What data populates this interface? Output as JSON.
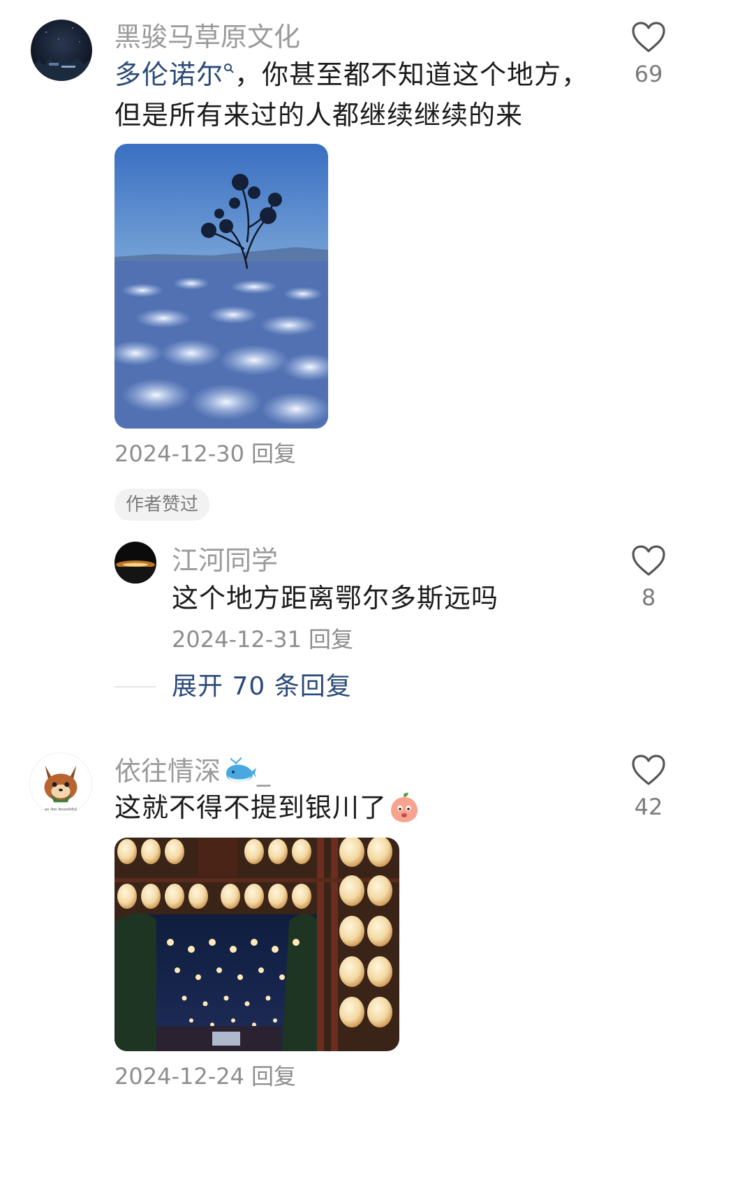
{
  "comments": [
    {
      "username": "黑骏马草原文化",
      "text_link": "多伦诺尔",
      "text_rest": "，你甚至都不知道这个地方，但是所有来过的人都继续继续的来",
      "date": "2024-12-30",
      "reply_label": "回复",
      "likes": "69",
      "author_liked": "作者赞过",
      "reply": {
        "username": "江河同学",
        "text": "这个地方距离鄂尔多斯远吗",
        "date": "2024-12-31",
        "reply_label": "回复",
        "likes": "8"
      },
      "expand_label": "展开 70 条回复"
    },
    {
      "username": "依往情深",
      "username_suffix": "_",
      "text": "这就不得不提到银川了",
      "date": "2024-12-24",
      "reply_label": "回复",
      "likes": "42"
    }
  ],
  "icons": {
    "like": "heart-outline-icon",
    "link_search": "search-icon",
    "whale": "whale-emoji-icon",
    "peach": "peach-emoji-icon"
  },
  "colors": {
    "link": "#2b4a78",
    "username": "#9a9a9a",
    "meta": "#8d8d8d"
  }
}
